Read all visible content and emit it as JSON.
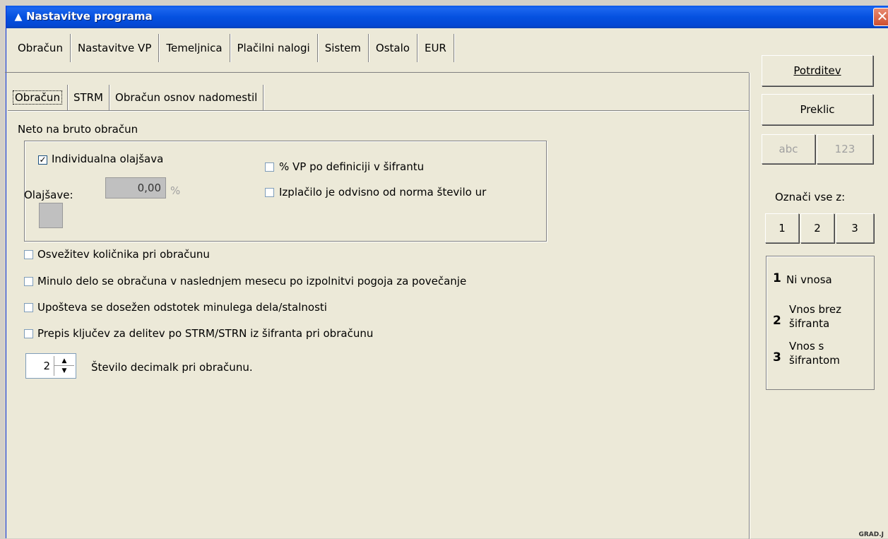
{
  "window": {
    "title": "Nastavitve programa",
    "close_glyph": "✕"
  },
  "main_tabs": [
    "Obračun",
    "Nastavitve VP",
    "Temeljnica",
    "Plačilni nalogi",
    "Sistem",
    "Ostalo",
    "EUR"
  ],
  "sub_tabs": [
    "Obračun",
    "STRM",
    "Obračun osnov nadomestil"
  ],
  "neto_bruto": {
    "heading": "Neto na bruto obračun",
    "individual_relief": {
      "label": "Individualna olajšava",
      "checked": true
    },
    "vp_definition": {
      "label": "% VP po definiciji v šifrantu",
      "checked": false
    },
    "payout_dependent": {
      "label": "Izplačilo je odvisno od norma število ur",
      "checked": false
    },
    "relief_label": "Olajšave:",
    "relief_value": "0,00",
    "relief_unit": "%"
  },
  "options": [
    {
      "label": "Osvežitev količnika pri obračunu",
      "checked": false
    },
    {
      "label": "Minulo delo se obračuna v naslednjem mesecu po izpolnitvi pogoja za povečanje",
      "checked": false
    },
    {
      "label": "Upošteva se dosežen odstotek minulega dela/stalnosti",
      "checked": false
    },
    {
      "label": "Prepis ključev za delitev po STRM/STRN iz šifranta pri obračunu",
      "checked": false
    }
  ],
  "decimals": {
    "value": "2",
    "label": "Število decimalk pri obračunu."
  },
  "right_panel": {
    "confirm_label": "Potrditev",
    "cancel_label": "Preklic",
    "abc_label": "abc",
    "num_label": "123",
    "mark_all_label": "Označi vse z:",
    "mark_buttons": [
      "1",
      "2",
      "3"
    ],
    "legend": [
      {
        "num": "1",
        "text": "Ni vnosa"
      },
      {
        "num": "2",
        "text": "Vnos brez šifranta"
      },
      {
        "num": "3",
        "text": "Vnos s šifrantom"
      }
    ]
  },
  "corner_text": "GRAD.J",
  "colors": {
    "titlebar": "#0551e0",
    "window_bg": "#ece9d8",
    "close_button": "#d05030"
  }
}
